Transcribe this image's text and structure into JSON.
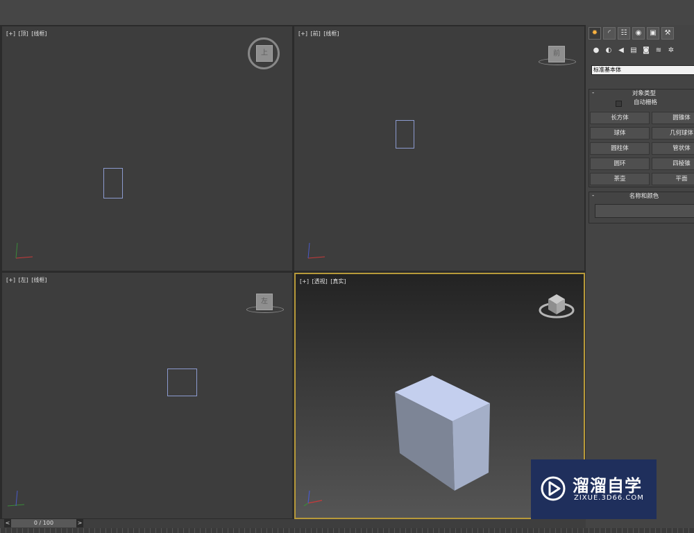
{
  "viewports": {
    "top": {
      "plus": "[+]",
      "view": "[顶]",
      "mode": "[线框]",
      "cube_label": "上"
    },
    "front": {
      "plus": "[+]",
      "view": "[前]",
      "mode": "[线框]",
      "cube_label": "前"
    },
    "left": {
      "plus": "[+]",
      "view": "[左]",
      "mode": "[线框]",
      "cube_label": "左"
    },
    "perspective": {
      "plus": "[+]",
      "view": "[透视]",
      "mode": "[真实]"
    }
  },
  "command_panel": {
    "tabs": [
      "create-tab",
      "modify-tab",
      "hierarchy-tab",
      "motion-tab",
      "display-tab",
      "utilities-tab"
    ],
    "category_dropdown": "标准基本体",
    "object_type": {
      "title": "对象类型",
      "collapse": "-",
      "autogrid_label": "自动栅格",
      "buttons": [
        "长方体",
        "圆锥体",
        "球体",
        "几何球体",
        "圆柱体",
        "管状体",
        "圆环",
        "四棱锥",
        "茶壶",
        "平面"
      ]
    },
    "name_color": {
      "title": "名称和颜色",
      "collapse": "-"
    }
  },
  "timeline": {
    "prev": "<",
    "next": ">",
    "frame": "0 / 100"
  },
  "watermark": {
    "title": "溜溜自学",
    "url": "ZIXUE.3D66.COM"
  },
  "colors": {
    "active_viewport_border": "#b89a3a",
    "selection_outline": "#8c9bd0",
    "box_face": "#a9b6d8"
  }
}
